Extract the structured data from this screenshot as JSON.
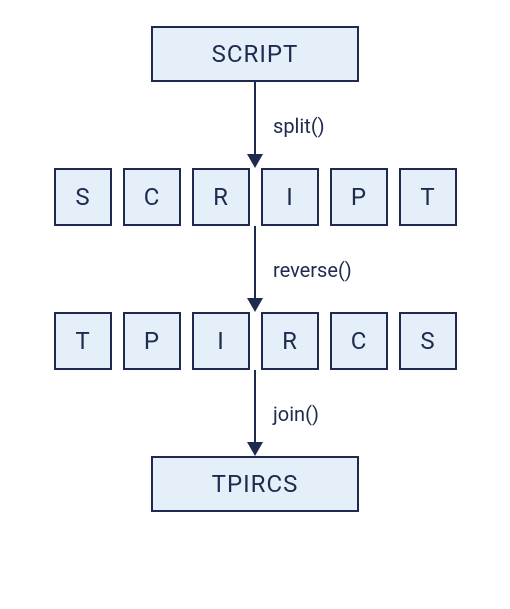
{
  "top_box": "SCRIPT",
  "step1_label": "split()",
  "row1": [
    "S",
    "C",
    "R",
    "I",
    "P",
    "T"
  ],
  "step2_label": "reverse()",
  "row2": [
    "T",
    "P",
    "I",
    "R",
    "C",
    "S"
  ],
  "step3_label": "join()",
  "bottom_box": "TPIRCS"
}
